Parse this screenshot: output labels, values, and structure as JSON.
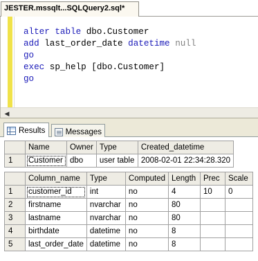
{
  "document_tab": {
    "title": "JESTER.mssqlt...SQLQuery2.sql*"
  },
  "editor": {
    "lines": [
      [
        {
          "t": "alter table ",
          "c": "kw"
        },
        {
          "t": "dbo.Customer",
          "c": "tx"
        }
      ],
      [
        {
          "t": "add ",
          "c": "kw"
        },
        {
          "t": "last_order_date ",
          "c": "tx"
        },
        {
          "t": "datetime ",
          "c": "kw"
        },
        {
          "t": "null",
          "c": "gr"
        }
      ],
      [
        {
          "t": "go",
          "c": "kw"
        }
      ],
      [
        {
          "t": "exec ",
          "c": "kw"
        },
        {
          "t": "sp_help ",
          "c": "tx"
        },
        {
          "t": "[dbo.Customer]",
          "c": "tx"
        }
      ],
      [
        {
          "t": "go",
          "c": "kw"
        }
      ]
    ]
  },
  "result_tabs": {
    "results_label": "Results",
    "messages_label": "Messages"
  },
  "grid1": {
    "headers": [
      "Name",
      "Owner",
      "Type",
      "Created_datetime"
    ],
    "rows": [
      {
        "num": "1",
        "cells": [
          "Customer",
          "dbo",
          "user table",
          "2008-02-01 22:34:28.320"
        ]
      }
    ]
  },
  "grid2": {
    "headers": [
      "Column_name",
      "Type",
      "Computed",
      "Length",
      "Prec",
      "Scale"
    ],
    "rows": [
      {
        "num": "1",
        "cells": [
          "customer_id",
          "int",
          "no",
          "4",
          "10",
          "0"
        ]
      },
      {
        "num": "2",
        "cells": [
          "firstname",
          "nvarchar",
          "no",
          "80",
          "",
          ""
        ]
      },
      {
        "num": "3",
        "cells": [
          "lastname",
          "nvarchar",
          "no",
          "80",
          "",
          ""
        ]
      },
      {
        "num": "4",
        "cells": [
          "birthdate",
          "datetime",
          "no",
          "8",
          "",
          ""
        ]
      },
      {
        "num": "5",
        "cells": [
          "last_order_date",
          "datetime",
          "no",
          "8",
          "",
          ""
        ]
      }
    ]
  }
}
